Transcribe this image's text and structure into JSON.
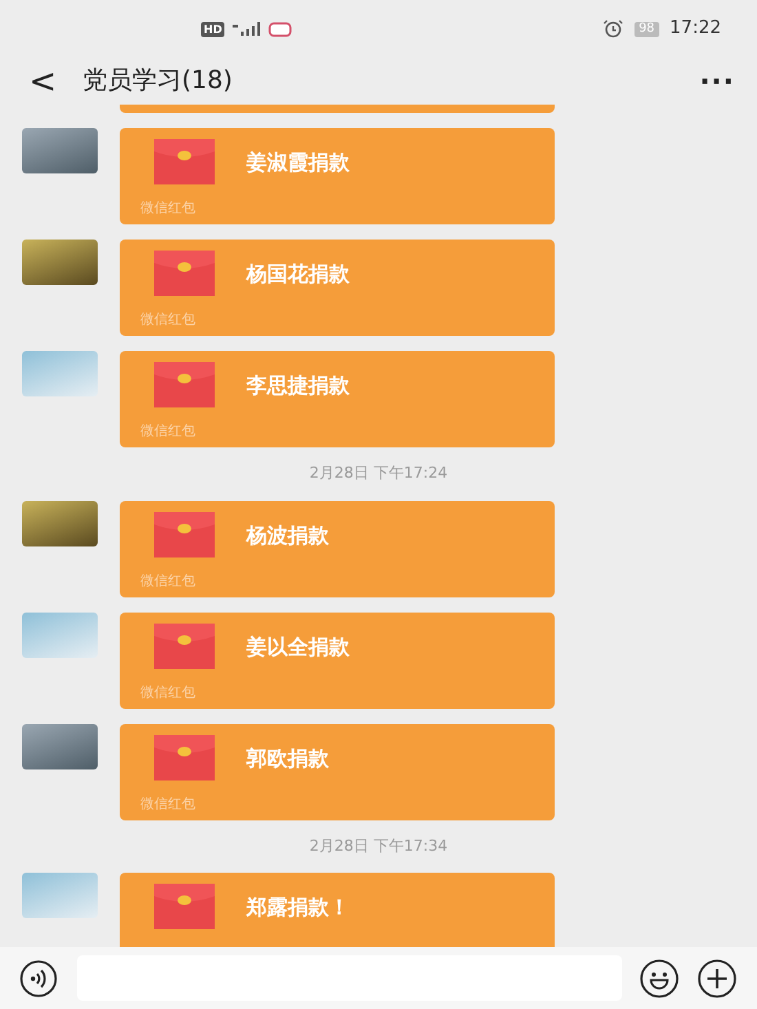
{
  "status_bar": {
    "hd_label": "HD",
    "battery": "98",
    "time": "17:22"
  },
  "header": {
    "back": "<",
    "title": "党员学习(18)",
    "more": "···"
  },
  "messages": [
    {
      "kind": "cut_off"
    },
    {
      "kind": "red_packet",
      "text": "姜淑霞捐款",
      "caption": "微信红包"
    },
    {
      "kind": "red_packet",
      "text": "杨国花捐款",
      "caption": "微信红包"
    },
    {
      "kind": "red_packet",
      "text": "李思捷捐款",
      "caption": "微信红包"
    },
    {
      "kind": "time",
      "text": "2月28日 下午17:24"
    },
    {
      "kind": "red_packet",
      "text": "杨波捐款",
      "caption": "微信红包"
    },
    {
      "kind": "red_packet",
      "text": "姜以全捐款",
      "caption": "微信红包"
    },
    {
      "kind": "red_packet",
      "text": "郭欧捐款",
      "caption": "微信红包"
    },
    {
      "kind": "time",
      "text": "2月28日 下午17:34"
    },
    {
      "kind": "red_packet",
      "text": "郑露捐款！"
    }
  ]
}
